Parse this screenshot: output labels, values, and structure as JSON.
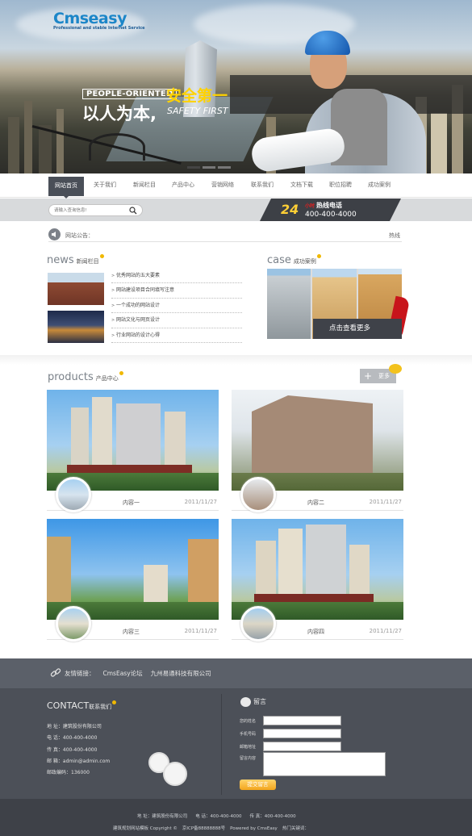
{
  "header": {
    "logo_text": "Cmseasy",
    "logo_tagline": "Professional and stable Internet Service",
    "slogan_en": "PEOPLE-ORIENTED",
    "slogan_cn_safety": "安全第一",
    "slogan_cn_people": "以人为本,",
    "slogan_en_safety": "SAFETY FIRST"
  },
  "nav": {
    "items": [
      "网站首页",
      "关于我们",
      "新闻栏目",
      "产品中心",
      "营销网络",
      "联系我们",
      "文档下载",
      "职位招聘",
      "成功案例"
    ]
  },
  "search": {
    "placeholder": "请输入查询信息!"
  },
  "hotline": {
    "badge": "24",
    "hour_tag": "小时",
    "label": "热线电话",
    "number": "400-400-4000"
  },
  "notice": {
    "label": "网站公告：",
    "more": "热线"
  },
  "news": {
    "title": "news",
    "subtitle": "新闻栏目",
    "items": [
      "优秀网站的五大要素",
      "网站建设项目合同填写注意",
      "一个成功的网站设计",
      "网站文化与网页设计",
      "行业网站的设计心得"
    ]
  },
  "case": {
    "title": "case",
    "subtitle": "成功案例",
    "button": "点击查看更多"
  },
  "products": {
    "title": "products",
    "subtitle": "产品中心",
    "more": "更多",
    "items": [
      {
        "name": "内容一",
        "date": "2011/11/27"
      },
      {
        "name": "内容二",
        "date": "2011/11/27"
      },
      {
        "name": "内容三",
        "date": "2011/11/27"
      },
      {
        "name": "内容四",
        "date": "2011/11/27"
      }
    ]
  },
  "links": {
    "label": "友情链接：",
    "items": [
      "CmsEasy论坛",
      "九州易通科技有限公司"
    ]
  },
  "contact": {
    "title": "CONTACT",
    "subtitle": "联系我们",
    "lines": [
      "地 址：建筑股份有限公司",
      "电 话：400-400-4000",
      "传 真：400-400-4000",
      "邮 箱：admin@admin.com",
      "邮政编码：136000"
    ]
  },
  "message": {
    "title": "留言",
    "fields": [
      "您的姓名",
      "手机号码",
      "邮箱地址",
      "留言内容"
    ],
    "submit": "提交留言"
  },
  "footer": {
    "address": "地 址：建筑股份有限公司",
    "phone": "电 话：400-400-4000",
    "fax": "传 真：400-400-4000",
    "copyright": "建筑规划网站模板 Copyright ©",
    "icp": "京ICP备88888888号",
    "powered": "Powered by CmsEasy",
    "keywords": "热门关键词："
  },
  "colors": {
    "nav_active": "#4a4f58",
    "footer_bg": "#4c5058",
    "accent_yellow": "#ffd200",
    "hotline_bg": "#3d4046"
  }
}
